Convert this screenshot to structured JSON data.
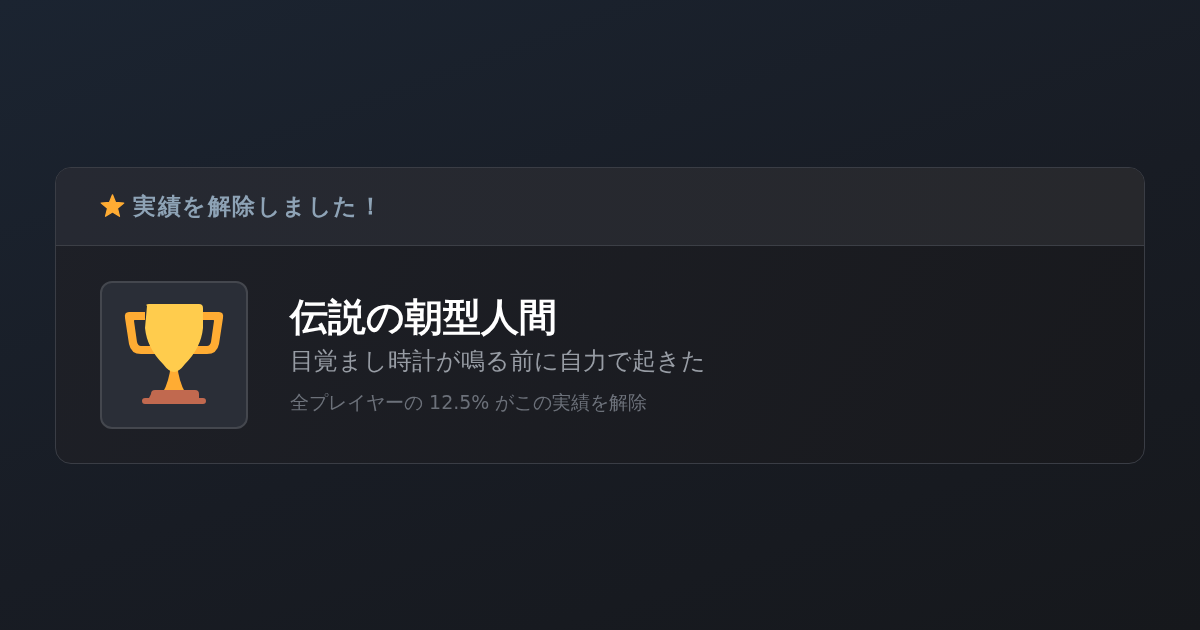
{
  "notification": {
    "header": {
      "title": "実績を解除しました！"
    },
    "achievement": {
      "name": "伝説の朝型人間",
      "description": "目覚まし時計が鳴る前に自力で起きた",
      "unlock_rate": "全プレイヤーの 12.5% がこの実績を解除"
    }
  }
}
